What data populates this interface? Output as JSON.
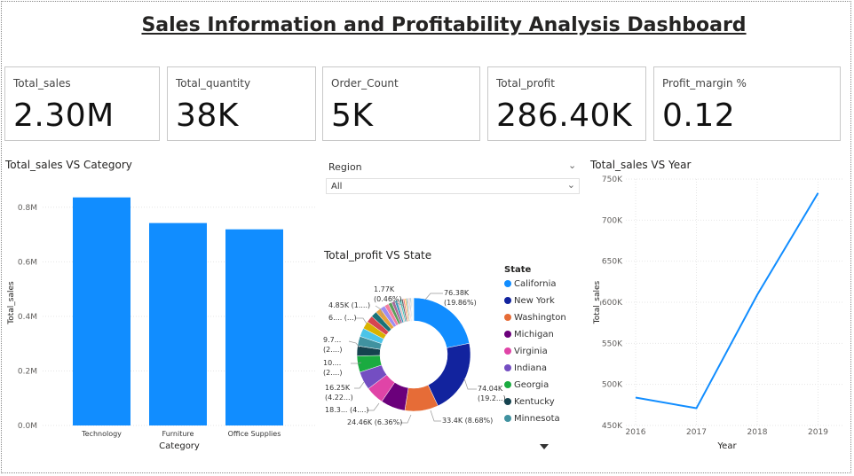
{
  "title": "Sales Information and Profitability Analysis Dashboard",
  "kpis": [
    {
      "label": "Total_sales",
      "value": "2.30M"
    },
    {
      "label": "Total_quantity",
      "value": "38K"
    },
    {
      "label": "Order_Count",
      "value": "5K"
    },
    {
      "label": "Total_profit",
      "value": "286.40K"
    },
    {
      "label": "Profit_margin %",
      "value": "0.12"
    }
  ],
  "slicer": {
    "label": "Region",
    "value": "All"
  },
  "colors": {
    "accent": "#118DFF",
    "text": "#252423"
  },
  "chart_data": [
    {
      "type": "bar",
      "title": "Total_sales VS Category",
      "xlabel": "Category",
      "ylabel": "Total_sales",
      "categories": [
        "Technology",
        "Furniture",
        "Office Supplies"
      ],
      "values": [
        836000,
        742000,
        719000
      ],
      "ylim": [
        0,
        900000
      ],
      "yticks": [
        "0.0M",
        "0.2M",
        "0.4M",
        "0.6M",
        "0.8M"
      ],
      "grid": true
    },
    {
      "type": "pie",
      "title": "Total_profit VS State",
      "legend_title": "State",
      "legend": [
        "California",
        "New York",
        "Washington",
        "Michigan",
        "Virginia",
        "Indiana",
        "Georgia",
        "Kentucky",
        "Minnesota"
      ],
      "slices": [
        {
          "name": "California",
          "value": 76.38,
          "color": "#118DFF"
        },
        {
          "name": "New York",
          "value": 74.04,
          "color": "#12239E"
        },
        {
          "name": "Washington",
          "value": 33.4,
          "color": "#E66C37"
        },
        {
          "name": "Michigan",
          "value": 24.46,
          "color": "#6B007B"
        },
        {
          "name": "Virginia",
          "value": 18.3,
          "color": "#E044A7"
        },
        {
          "name": "Indiana",
          "value": 18.3,
          "color": "#744EC2"
        },
        {
          "name": "Georgia",
          "value": 16.25,
          "color": "#1AAB40"
        },
        {
          "name": "Kentucky",
          "value": 10.0,
          "color": "#15434F"
        },
        {
          "name": "Minnesota",
          "value": 9.7,
          "color": "#4092A0"
        },
        {
          "name": "",
          "value": 8.5,
          "color": "#4BC4E8"
        },
        {
          "name": "",
          "value": 7.6,
          "color": "#D9B300"
        },
        {
          "name": "",
          "value": 6.8,
          "color": "#D64550"
        },
        {
          "name": "",
          "value": 6.0,
          "color": "#197278"
        },
        {
          "name": "",
          "value": 5.5,
          "color": "#E8A33D"
        },
        {
          "name": "",
          "value": 4.85,
          "color": "#9D8DF1"
        },
        {
          "name": "",
          "value": 4.2,
          "color": "#F47F9F"
        },
        {
          "name": "",
          "value": 3.6,
          "color": "#5B9E5B"
        },
        {
          "name": "",
          "value": 3.1,
          "color": "#A66999"
        },
        {
          "name": "",
          "value": 2.6,
          "color": "#3599B8"
        },
        {
          "name": "",
          "value": 2.2,
          "color": "#DFBFBF"
        },
        {
          "name": "",
          "value": 1.9,
          "color": "#4AC5BB"
        },
        {
          "name": "",
          "value": 1.77,
          "color": "#5F6B6D"
        },
        {
          "name": "",
          "value": 1.6,
          "color": "#FB8281"
        },
        {
          "name": "",
          "value": 1.4,
          "color": "#F4D25A"
        },
        {
          "name": "",
          "value": 1.2,
          "color": "#7F898A"
        },
        {
          "name": "",
          "value": 1.0,
          "color": "#A4DDEE"
        },
        {
          "name": "",
          "value": 0.9,
          "color": "#FDAB89"
        },
        {
          "name": "",
          "value": 0.8,
          "color": "#B687AC"
        },
        {
          "name": "",
          "value": 0.7,
          "color": "#28738A"
        },
        {
          "name": "",
          "value": 0.6,
          "color": "#A78F8F"
        },
        {
          "name": "",
          "value": 0.5,
          "color": "#168980"
        },
        {
          "name": "",
          "value": 0.5,
          "color": "#B59525"
        },
        {
          "name": "",
          "value": 0.4,
          "color": "#8AD4EB"
        },
        {
          "name": "",
          "value": 0.4,
          "color": "#FE9666"
        },
        {
          "name": "",
          "value": 0.3,
          "color": "#A66999"
        },
        {
          "name": "",
          "value": 0.3,
          "color": "#3599B8"
        }
      ],
      "data_labels": [
        {
          "line1": "76.38K",
          "line2": "(19.86%)"
        },
        {
          "line1": "74.04K",
          "line2": "(19.2...)"
        },
        {
          "line1": "33.4K (8.68%)",
          "line2": ""
        },
        {
          "line1": "24.46K (6.36%)",
          "line2": ""
        },
        {
          "line1": "18.3... (4....)",
          "line2": ""
        },
        {
          "line1": "16.25K",
          "line2": "(4.22...)"
        },
        {
          "line1": "10....",
          "line2": "(2....)"
        },
        {
          "line1": "9.7...",
          "line2": "(2....)"
        },
        {
          "line1": "6.... (...)",
          "line2": ""
        },
        {
          "line1": "4.85K (1....)",
          "line2": ""
        },
        {
          "line1": "1.77K",
          "line2": "(0.46%)"
        }
      ]
    },
    {
      "type": "line",
      "title": "Total_sales VS Year",
      "xlabel": "Year",
      "ylabel": "Total_sales",
      "x": [
        "2016",
        "2017",
        "2018",
        "2019"
      ],
      "y": [
        484000,
        471000,
        609000,
        733000
      ],
      "ylim": [
        450000,
        750000
      ],
      "yticks": [
        "450K",
        "500K",
        "550K",
        "600K",
        "650K",
        "700K",
        "750K"
      ],
      "grid": true
    }
  ]
}
